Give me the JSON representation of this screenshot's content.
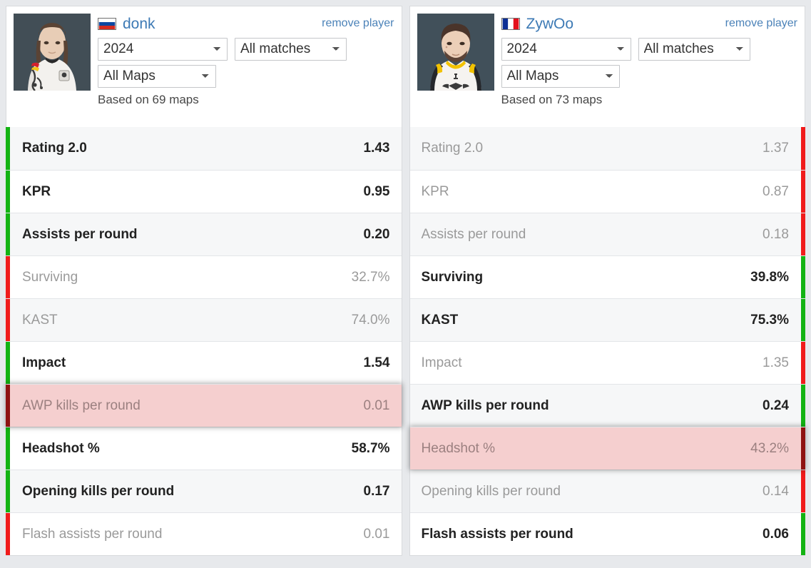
{
  "page": {
    "background": "#e7e9ec",
    "link_color": "#4b82b8",
    "win_color": "#13b313",
    "lose_color": "#f01b1b",
    "highlight_bg": "#f5cfcf"
  },
  "players": [
    {
      "name": "donk",
      "flag": "russia-flag",
      "remove_label": "remove player",
      "year_select": "2024",
      "match_select": "All matches",
      "map_select": "All Maps",
      "based_on": "Based on 69 maps",
      "photo": "player-photo-donk"
    },
    {
      "name": "ZywOo",
      "flag": "france-flag",
      "remove_label": "remove player",
      "year_select": "2024",
      "match_select": "All matches",
      "map_select": "All Maps",
      "based_on": "Based on 73 maps",
      "photo": "player-photo-zywoo"
    }
  ],
  "stats": {
    "left": [
      {
        "label": "Rating 2.0",
        "value": "1.43",
        "result": "win",
        "highlight": false
      },
      {
        "label": "KPR",
        "value": "0.95",
        "result": "win",
        "highlight": false
      },
      {
        "label": "Assists per round",
        "value": "0.20",
        "result": "win",
        "highlight": false
      },
      {
        "label": "Surviving",
        "value": "32.7%",
        "result": "lose",
        "highlight": false
      },
      {
        "label": "KAST",
        "value": "74.0%",
        "result": "lose",
        "highlight": false
      },
      {
        "label": "Impact",
        "value": "1.54",
        "result": "win",
        "highlight": false
      },
      {
        "label": "AWP kills per round",
        "value": "0.01",
        "result": "lose",
        "highlight": true
      },
      {
        "label": "Headshot %",
        "value": "58.7%",
        "result": "win",
        "highlight": false
      },
      {
        "label": "Opening kills per round",
        "value": "0.17",
        "result": "win",
        "highlight": false
      },
      {
        "label": "Flash assists per round",
        "value": "0.01",
        "result": "lose",
        "highlight": false
      }
    ],
    "right": [
      {
        "label": "Rating 2.0",
        "value": "1.37",
        "result": "lose",
        "highlight": false
      },
      {
        "label": "KPR",
        "value": "0.87",
        "result": "lose",
        "highlight": false
      },
      {
        "label": "Assists per round",
        "value": "0.18",
        "result": "lose",
        "highlight": false
      },
      {
        "label": "Surviving",
        "value": "39.8%",
        "result": "win",
        "highlight": false
      },
      {
        "label": "KAST",
        "value": "75.3%",
        "result": "win",
        "highlight": false
      },
      {
        "label": "Impact",
        "value": "1.35",
        "result": "lose",
        "highlight": false
      },
      {
        "label": "AWP kills per round",
        "value": "0.24",
        "result": "win",
        "highlight": false
      },
      {
        "label": "Headshot %",
        "value": "43.2%",
        "result": "lose",
        "highlight": true
      },
      {
        "label": "Opening kills per round",
        "value": "0.14",
        "result": "lose",
        "highlight": false
      },
      {
        "label": "Flash assists per round",
        "value": "0.06",
        "result": "win",
        "highlight": false
      }
    ]
  }
}
